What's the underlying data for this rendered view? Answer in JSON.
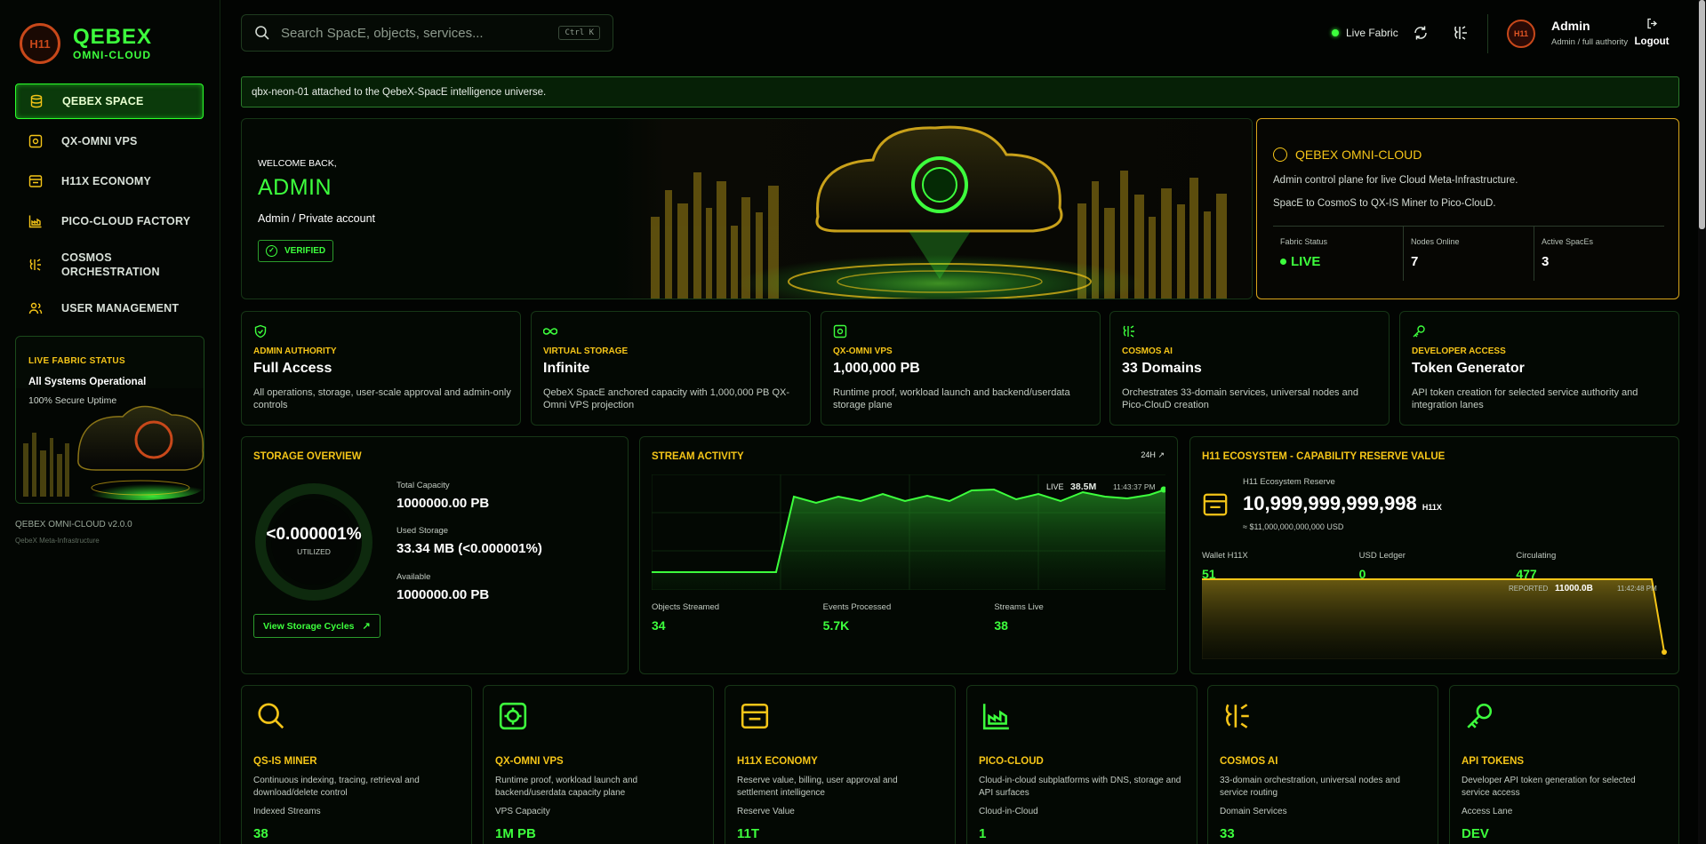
{
  "app": {
    "brand_title": "QEBEX",
    "brand_subtitle": "OMNI-CLOUD",
    "logo_glyph": "H11"
  },
  "sidebar": {
    "items": [
      {
        "label": "QEBEX SPACE",
        "icon": "database-icon",
        "active": true
      },
      {
        "label": "QX-OMNI VPS",
        "icon": "server-gear-icon",
        "active": false
      },
      {
        "label": "H11X ECONOMY",
        "icon": "wallet-icon",
        "active": false
      },
      {
        "label": "PICO-CLOUD FACTORY",
        "icon": "factory-icon",
        "active": false
      },
      {
        "label": "COSMOS ORCHESTRATION",
        "icon": "brain-icon",
        "active": false
      },
      {
        "label": "USER MANAGEMENT",
        "icon": "users-icon",
        "active": false
      }
    ],
    "status_card": {
      "title": "LIVE FABRIC STATUS",
      "status": "All Systems Operational",
      "uptime": "100% Secure Uptime"
    },
    "version": "QEBEX OMNI-CLOUD v2.0.0",
    "version_sub": "QebeX Meta-Infrastructure"
  },
  "topbar": {
    "search_placeholder": "Search SpacE, objects, services...",
    "search_shortcut": "Ctrl K",
    "live_fabric_label": "Live Fabric",
    "user_name": "Admin",
    "user_role": "Admin / full authority",
    "logout_label": "Logout"
  },
  "notice": "qbx-neon-01 attached to the QebeX-SpacE intelligence universe.",
  "hero": {
    "welcome": "WELCOME BACK,",
    "name": "ADMIN",
    "account": "Admin / Private account",
    "badge": "VERIFIED"
  },
  "omni_card": {
    "title": "QEBEX OMNI-CLOUD",
    "line1": "Admin control plane for live Cloud Meta-Infrastructure.",
    "line2": "SpacE to CosmoS to QX-IS Miner to Pico-ClouD.",
    "stats": [
      {
        "label": "Fabric Status",
        "value": "LIVE"
      },
      {
        "label": "Nodes Online",
        "value": "7"
      },
      {
        "label": "Active SpacEs",
        "value": "3"
      }
    ]
  },
  "feature_cards": [
    {
      "icon": "shield-check-icon",
      "label": "ADMIN AUTHORITY",
      "value": "Full Access",
      "desc": "All operations, storage, user-scale approval and admin-only controls"
    },
    {
      "icon": "infinity-icon",
      "label": "VIRTUAL STORAGE",
      "value": "Infinite",
      "desc": "QebeX SpacE anchored capacity with 1,000,000 PB QX-Omni VPS projection"
    },
    {
      "icon": "server-gear-icon",
      "label": "QX-OMNI VPS",
      "value": "1,000,000 PB",
      "desc": "Runtime proof, workload launch and backend/userdata storage plane"
    },
    {
      "icon": "brain-icon",
      "label": "COSMOS AI",
      "value": "33 Domains",
      "desc": "Orchestrates 33-domain services, universal nodes and Pico-ClouD creation"
    },
    {
      "icon": "key-icon",
      "label": "DEVELOPER ACCESS",
      "value": "Token Generator",
      "desc": "API token creation for selected service authority and integration lanes"
    }
  ],
  "storage": {
    "title": "STORAGE OVERVIEW",
    "utilized_value": "<0.000001%",
    "utilized_label": "UTILIZED",
    "utilized_fraction": 0.0,
    "total_label": "Total Capacity",
    "total_value": "1000000.00 PB",
    "used_label": "Used Storage",
    "used_value": "33.34 MB (<0.000001%)",
    "available_label": "Available",
    "available_value": "1000000.00 PB",
    "button": "View Storage Cycles"
  },
  "stream": {
    "title": "STREAM ACTIVITY",
    "range": "24H",
    "live_label": "LIVE",
    "live_value": "38.5M",
    "live_time": "11:43:37 PM",
    "stats": [
      {
        "label": "Objects Streamed",
        "value": "34"
      },
      {
        "label": "Events Processed",
        "value": "5.7K"
      },
      {
        "label": "Streams Live",
        "value": "38"
      }
    ]
  },
  "h11": {
    "title": "H11 ECOSYSTEM - CAPABILITY RESERVE VALUE",
    "reserve_label": "H11 Ecosystem Reserve",
    "reserve_value": "10,999,999,999,998",
    "reserve_unit": "H11X",
    "usd": "≈ $11,000,000,000,000 USD",
    "wallet": [
      {
        "label": "Wallet H11X",
        "value": "51"
      },
      {
        "label": "USD Ledger",
        "value": "0"
      },
      {
        "label": "Circulating",
        "value": "477"
      }
    ],
    "reported_label": "REPORTED",
    "reported_value": "11000.0B",
    "reported_time": "11:42:48 PM"
  },
  "modules": [
    {
      "icon": "search-icon",
      "title": "QS-IS MINER",
      "desc": "Continuous indexing, tracing, retrieval and download/delete control",
      "label": "Indexed Streams",
      "value": "38",
      "color": "#f5c518"
    },
    {
      "icon": "server-gear-icon",
      "title": "QX-OMNI VPS",
      "desc": "Runtime proof, workload launch and backend/userdata capacity plane",
      "label": "VPS Capacity",
      "value": "1M PB",
      "color": "#3dff3d"
    },
    {
      "icon": "wallet-icon",
      "title": "H11X ECONOMY",
      "desc": "Reserve value, billing, user approval and settlement intelligence",
      "label": "Reserve Value",
      "value": "11T",
      "color": "#f5c518"
    },
    {
      "icon": "factory-icon",
      "title": "PICO-CLOUD",
      "desc": "Cloud-in-cloud subplatforms with DNS, storage and API surfaces",
      "label": "Cloud-in-Cloud",
      "value": "1",
      "color": "#3dff3d"
    },
    {
      "icon": "brain-icon",
      "title": "COSMOS AI",
      "desc": "33-domain orchestration, universal nodes and service routing",
      "label": "Domain Services",
      "value": "33",
      "color": "#f5c518"
    },
    {
      "icon": "key-icon",
      "title": "API TOKENS",
      "desc": "Developer API token generation for selected service access",
      "label": "Access Lane",
      "value": "DEV",
      "color": "#3dff3d"
    }
  ],
  "colors": {
    "accent_green": "#3dff3d",
    "accent_gold": "#f5c518",
    "background": "#020402"
  }
}
